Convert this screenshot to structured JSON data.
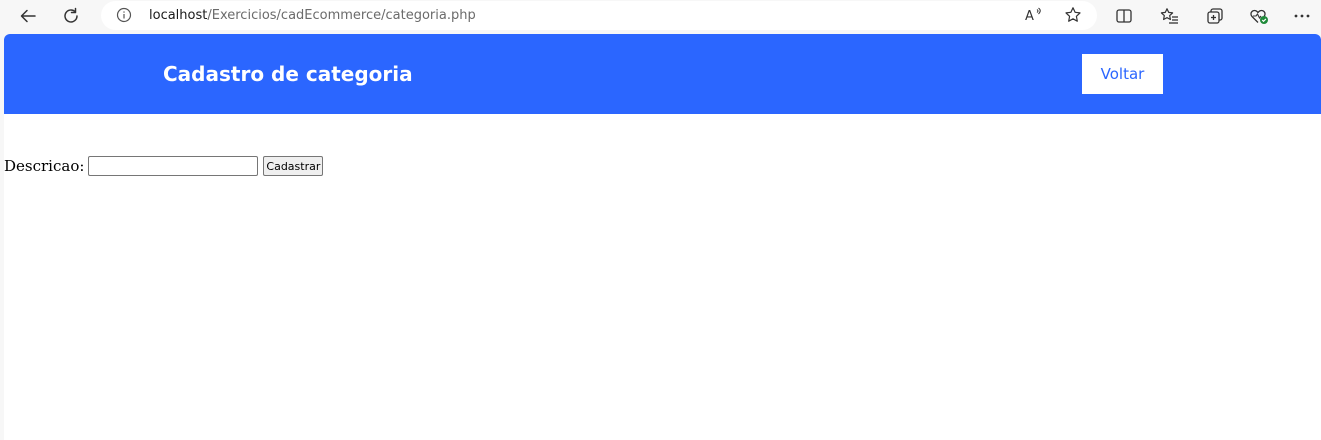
{
  "browser": {
    "url_host": "localhost",
    "url_path": "/Exercicios/cadEcommerce/categoria.php",
    "icons": {
      "back": "back-arrow-icon",
      "refresh": "refresh-icon",
      "info": "info-icon",
      "read_aloud": "read-aloud-icon",
      "favorite": "star-icon",
      "split_screen": "split-screen-icon",
      "favorites": "favorites-icon",
      "collections": "collections-icon",
      "health": "browser-essentials-icon",
      "menu": "more-icon"
    },
    "read_aloud_label": "A"
  },
  "header": {
    "title": "Cadastro de categoria",
    "back_link": "Voltar",
    "background_color": "#2b66ff",
    "title_color": "#ffffff"
  },
  "form": {
    "label": "Descricao:",
    "input_value": "",
    "submit_label": "Cadastrar"
  }
}
